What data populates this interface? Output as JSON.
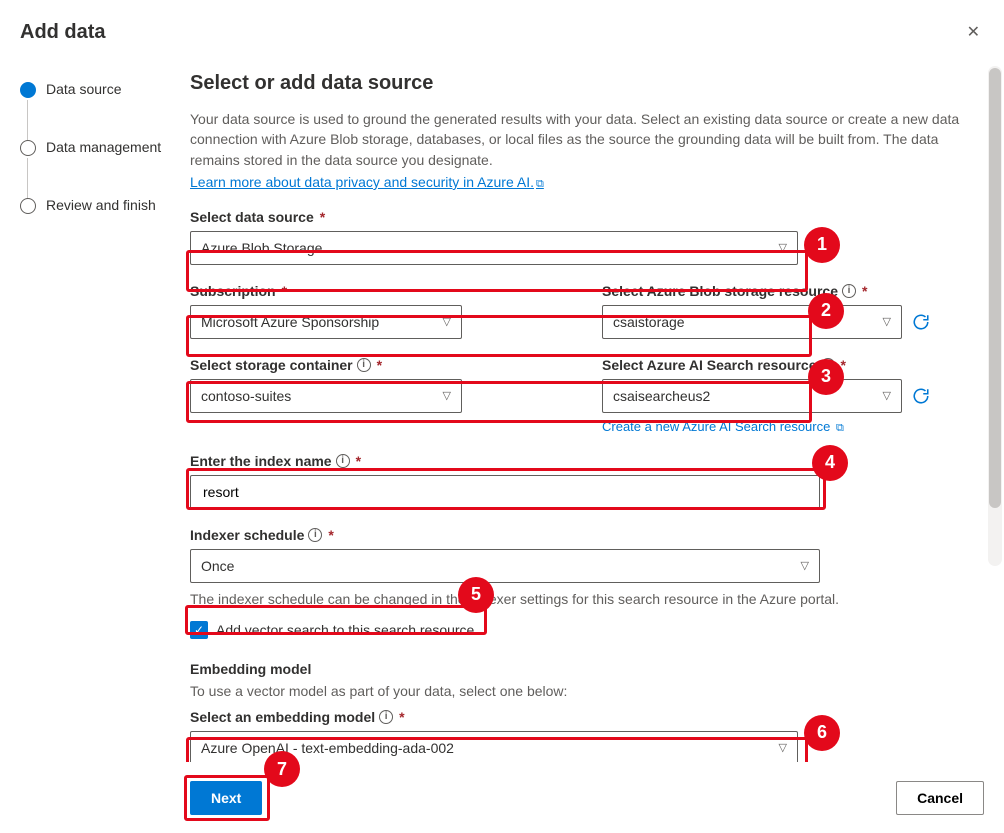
{
  "header": {
    "title": "Add data"
  },
  "steps": [
    {
      "label": "Data source",
      "active": true
    },
    {
      "label": "Data management",
      "active": false
    },
    {
      "label": "Review and finish",
      "active": false
    }
  ],
  "page": {
    "heading": "Select or add data source",
    "description": "Your data source is used to ground the generated results with your data. Select an existing data source or create a new data connection with Azure Blob storage, databases, or local files as the source the grounding data will be built from. The data remains stored in the data source you designate.",
    "learn_more": "Learn more about data privacy and security in Azure AI."
  },
  "fields": {
    "data_source": {
      "label": "Select data source",
      "value": "Azure Blob Storage"
    },
    "subscription": {
      "label": "Subscription",
      "value": "Microsoft Azure Sponsorship"
    },
    "blob_resource": {
      "label": "Select Azure Blob storage resource",
      "value": "csaistorage"
    },
    "storage_container": {
      "label": "Select storage container",
      "value": "contoso-suites"
    },
    "search_resource": {
      "label": "Select Azure AI Search resource",
      "value": "csaisearcheus2",
      "create_link": "Create a new Azure AI Search resource"
    },
    "index_name": {
      "label": "Enter the index name",
      "value": "resort"
    },
    "indexer_schedule": {
      "label": "Indexer schedule",
      "value": "Once",
      "hint": "The indexer schedule can be changed in the Indexer settings for this search resource in the Azure portal."
    },
    "vector_check": {
      "label": "Add vector search to this search resource."
    },
    "embedding": {
      "heading": "Embedding model",
      "desc": "To use a vector model as part of your data, select one below:",
      "label": "Select an embedding model",
      "value": "Azure OpenAI - text-embedding-ada-002"
    }
  },
  "buttons": {
    "next": "Next",
    "cancel": "Cancel"
  },
  "annotations": [
    {
      "n": "1"
    },
    {
      "n": "2"
    },
    {
      "n": "3"
    },
    {
      "n": "4"
    },
    {
      "n": "5"
    },
    {
      "n": "6"
    },
    {
      "n": "7"
    }
  ]
}
